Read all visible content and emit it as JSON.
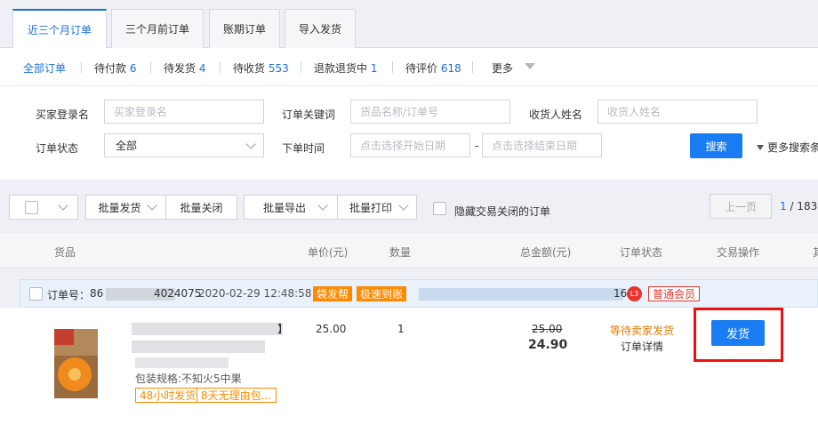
{
  "tabs": [
    {
      "label": "近三个月订单"
    },
    {
      "label": "三个月前订单"
    },
    {
      "label": "账期订单"
    },
    {
      "label": "导入发货"
    }
  ],
  "status_filters": [
    {
      "label": "全部订单",
      "count": ""
    },
    {
      "label": "待付款",
      "count": "6"
    },
    {
      "label": "待发货",
      "count": "4"
    },
    {
      "label": "待收货",
      "count": "553"
    },
    {
      "label": "退款退货中",
      "count": "1"
    },
    {
      "label": "待评价",
      "count": "618"
    },
    {
      "label": "更多",
      "count": ""
    }
  ],
  "filters": {
    "buyer_login_label": "买家登录名",
    "buyer_login_placeholder": "买家登录名",
    "keyword_label": "订单关键词",
    "keyword_placeholder": "货品名称/订单号",
    "receiver_label": "收货人姓名",
    "receiver_placeholder": "收货人姓名",
    "status_label": "订单状态",
    "status_value": "全部",
    "time_label": "下单时间",
    "start_placeholder": "点击选择开始日期",
    "range_sep": "-",
    "end_placeholder": "点击选择结束日期",
    "search_button": "搜索",
    "more_search": "更多搜索条"
  },
  "toolbar": {
    "batch_ship": "批量发货",
    "batch_close": "批量关闭",
    "batch_export": "批量导出",
    "batch_print": "批量打印",
    "hide_closed": "隐藏交易关闭的订单",
    "prev_page": "上一页",
    "current_page": "1",
    "total_pages": "/ 183"
  },
  "columns": {
    "goods": "货品",
    "unit_price": "单价(元)",
    "quantity": "数量",
    "total": "总金额(元)",
    "status": "订单状态",
    "operation": "交易操作",
    "extra": "其"
  },
  "order": {
    "number_label": "订单号：",
    "number_prefix": "86",
    "number_suffix": "4024075",
    "datetime": "2020-02-29 12:48:58",
    "tag1": "袋发帮",
    "tag2": "极速到账",
    "buyer_suffix": "16",
    "level_badge": "L3",
    "member_badge": "普通会员",
    "product_title_suffix": "\u0001",
    "product_partial": "】",
    "spec": "包装规格:不知火5中果",
    "badge_ship48": "48小时发货",
    "badge_return": "8天无理由包...",
    "unit_price": "25.00",
    "quantity": "1",
    "original_total": "25.00",
    "total": "24.90",
    "status_text": "等待卖家发货",
    "detail_link": "订单详情",
    "ship_button": "发货"
  },
  "colors": {
    "accent": "#1a7cf2",
    "link": "#1a6fd6",
    "tag_orange": "#ff8a00",
    "warning": "#e07b00",
    "highlight_red": "#f01010"
  }
}
